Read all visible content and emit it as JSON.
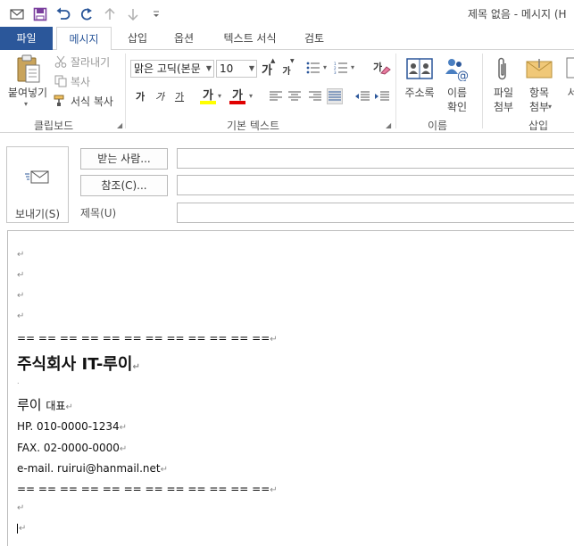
{
  "window": {
    "title": "제목 없음 - 메시지 (H"
  },
  "tabs": {
    "file": "파일",
    "message": "메시지",
    "insert": "삽입",
    "options": "옵션",
    "format_text": "텍스트 서식",
    "review": "검토"
  },
  "ribbon": {
    "clipboard": {
      "paste": "붙여넣기",
      "cut": "잘라내기",
      "copy": "복사",
      "format_painter": "서식 복사",
      "label": "클립보드"
    },
    "basic_text": {
      "font": "맑은 고딕(본문",
      "size": "10",
      "label": "기본 텍스트",
      "grow_glyph": "가",
      "shrink_glyph": "가",
      "bold_glyph": "가",
      "italic_glyph": "가",
      "underline_glyph": "가",
      "highlight_glyph": "가",
      "fontcolor_glyph": "가",
      "clear_glyph": "가",
      "highlight_color": "#ffff00",
      "fontcolor_color": "#e00000"
    },
    "names": {
      "address_book": "주소록",
      "check_names": "이름\n확인",
      "label": "이름"
    },
    "include": {
      "attach_file": "파일\n첨부",
      "attach_item": "항목\n첨부",
      "signature": "서",
      "label": "삽입"
    }
  },
  "header": {
    "send": "보내기(S)",
    "to": "받는 사람...",
    "cc": "참조(C)...",
    "subject": "제목(U)",
    "to_value": "",
    "cc_value": "",
    "subject_value": ""
  },
  "body": {
    "mark": "↵",
    "mark_small": ".",
    "divider": "== == == == == == == == == == == ==",
    "company": "주식회사 IT-루이",
    "name": "루이",
    "role": "대표",
    "hp": "HP. 010-0000-1234",
    "fax": "FAX. 02-0000-0000",
    "email": "e-mail. ruirui@hanmail.net"
  }
}
